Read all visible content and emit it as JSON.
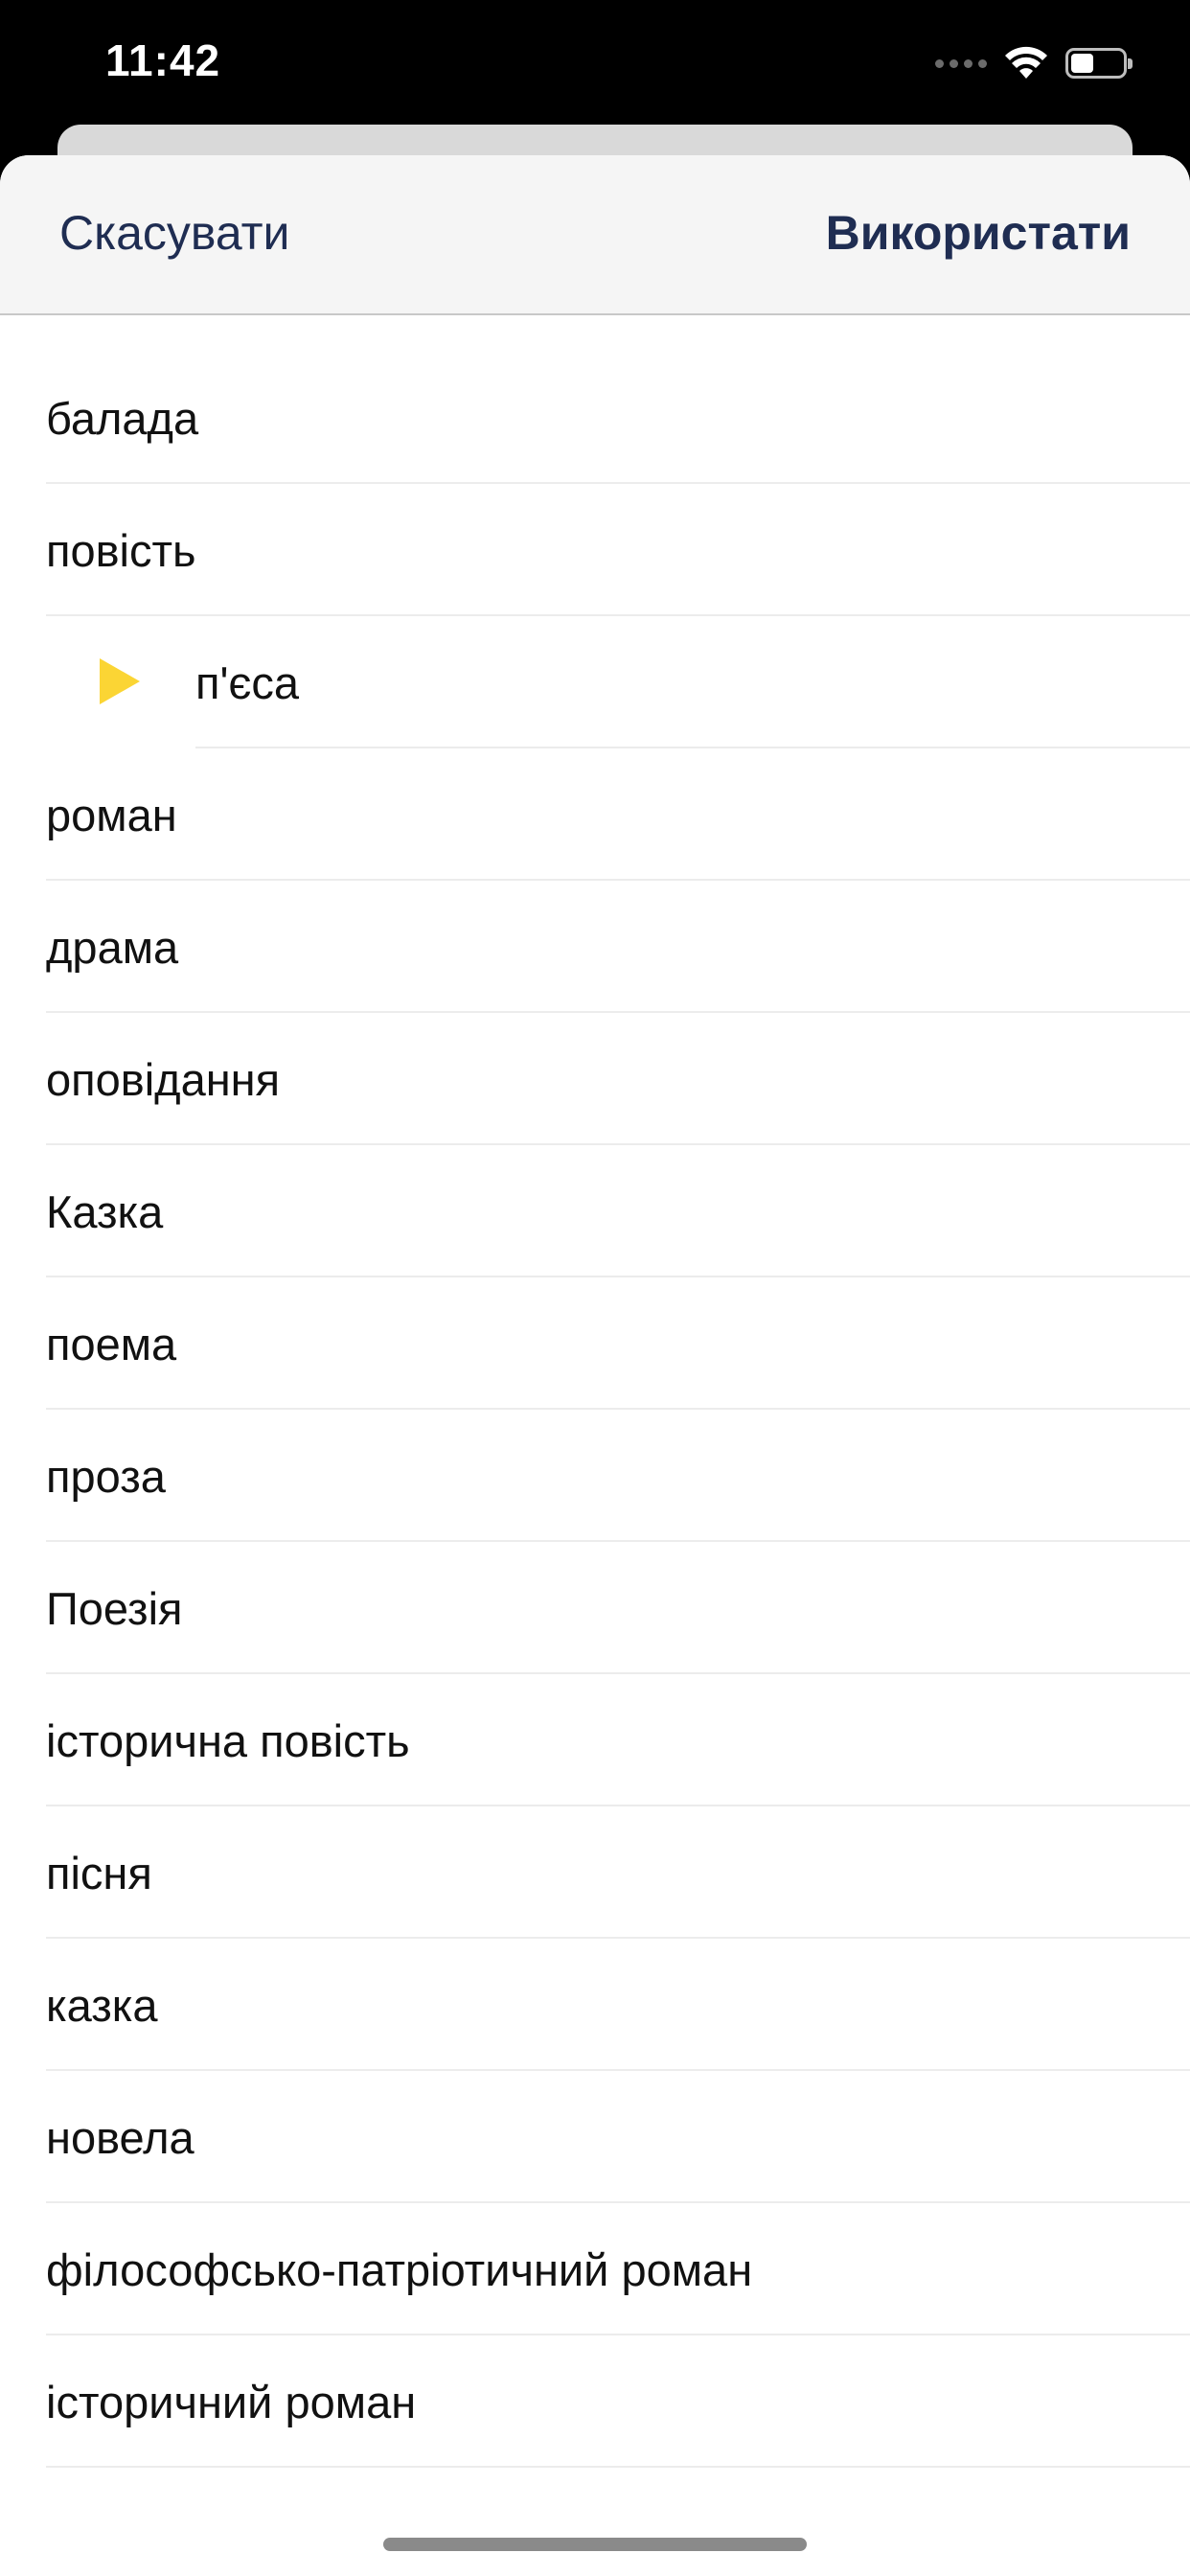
{
  "status_bar": {
    "time": "11:42",
    "battery_level": 0.45
  },
  "header": {
    "cancel_label": "Скасувати",
    "use_label": "Використати"
  },
  "list": {
    "items": [
      {
        "label": "балада",
        "nested": false
      },
      {
        "label": "повість",
        "nested": false
      },
      {
        "label": "п'єса",
        "nested": true,
        "icon": "play-icon",
        "icon_color": "#fbd534"
      },
      {
        "label": "роман",
        "nested": false
      },
      {
        "label": "драма",
        "nested": false
      },
      {
        "label": "оповідання",
        "nested": false
      },
      {
        "label": "Казка",
        "nested": false
      },
      {
        "label": "поема",
        "nested": false
      },
      {
        "label": "проза",
        "nested": false
      },
      {
        "label": "Поезія",
        "nested": false
      },
      {
        "label": "історична повість",
        "nested": false
      },
      {
        "label": "пісня",
        "nested": false
      },
      {
        "label": "казка",
        "nested": false
      },
      {
        "label": "новела",
        "nested": false
      },
      {
        "label": "філософсько-патріотичний роман",
        "nested": false
      },
      {
        "label": "історичний роман",
        "nested": false
      }
    ]
  },
  "colors": {
    "accent_text": "#1f2d52",
    "play_icon": "#fbd534",
    "header_bg": "#f5f5f5"
  }
}
